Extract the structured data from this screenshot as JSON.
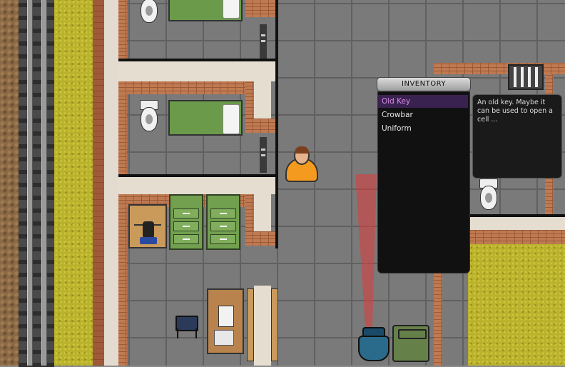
{
  "inventory": {
    "title": "INVENTORY",
    "items": [
      {
        "label": "Old Key",
        "selected": true
      },
      {
        "label": "Crowbar",
        "selected": false
      },
      {
        "label": "Uniform",
        "selected": false
      }
    ],
    "tooltip": "An old key. Maybe it can be used to open a cell ..."
  },
  "colors": {
    "selected_item_text": "#d98ae8",
    "selected_item_bg": "#3a2250",
    "player_outfit": "#f49a1e",
    "guard_vision": "#e03a3a"
  },
  "icons": [
    "old-key",
    "crowbar",
    "uniform"
  ]
}
